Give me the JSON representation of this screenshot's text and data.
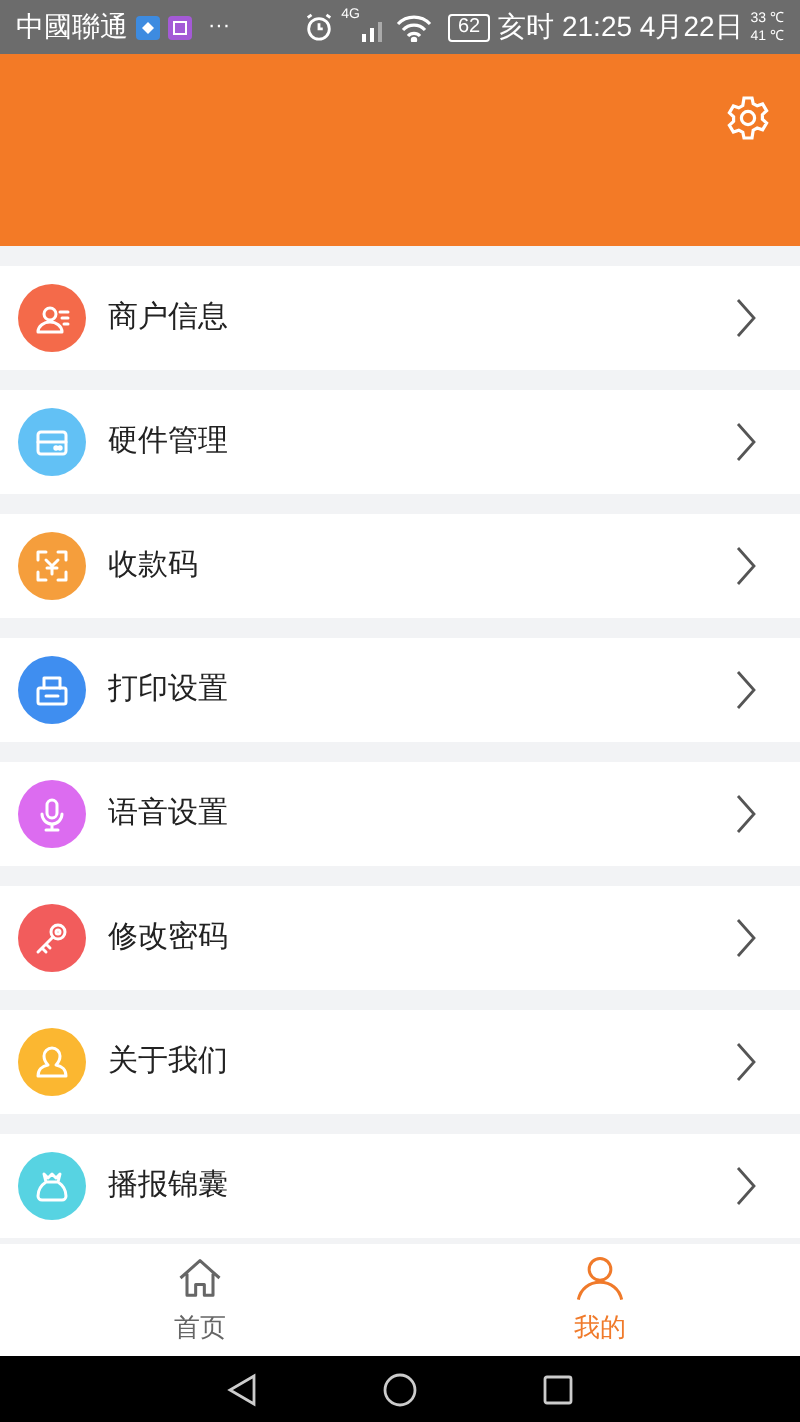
{
  "status_bar": {
    "carrier": "中國聯通",
    "more": "···",
    "network": "4G",
    "battery": "62",
    "clock": "亥时 21:25 4月22日",
    "temps": [
      "33 ℃",
      "41 ℃"
    ]
  },
  "menu_items": [
    {
      "label": "商户信息",
      "kind": "merchant",
      "color": "#f46a4a"
    },
    {
      "label": "硬件管理",
      "kind": "hardware",
      "color": "#62c1f5"
    },
    {
      "label": "收款码",
      "kind": "qrcode",
      "color": "#f59e3c"
    },
    {
      "label": "打印设置",
      "kind": "printer",
      "color": "#3f8ef0"
    },
    {
      "label": "语音设置",
      "kind": "voice",
      "color": "#dc6cf0"
    },
    {
      "label": "修改密码",
      "kind": "key",
      "color": "#f25c5c"
    },
    {
      "label": "关于我们",
      "kind": "about",
      "color": "#fbb731"
    },
    {
      "label": "播报锦囊",
      "kind": "bag",
      "color": "#57d3e2"
    }
  ],
  "tabs": [
    {
      "label": "首页",
      "kind": "home",
      "selected": false
    },
    {
      "label": "我的",
      "kind": "person",
      "selected": true
    }
  ]
}
